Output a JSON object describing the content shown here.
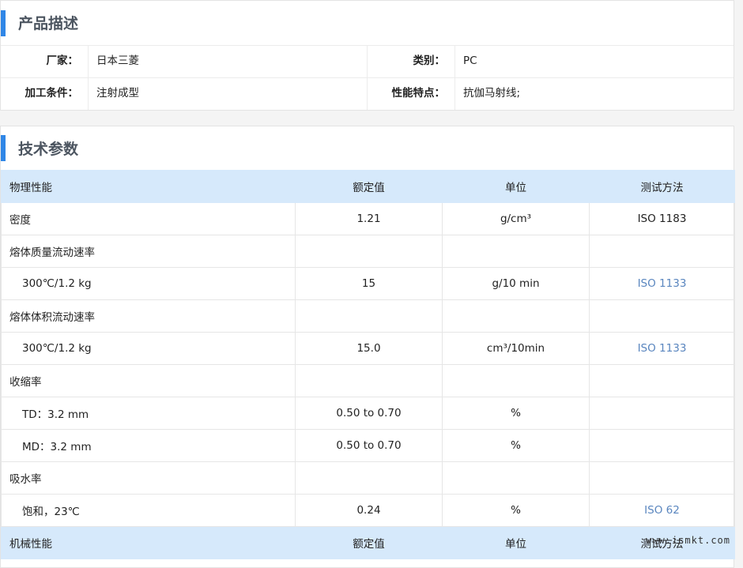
{
  "description_panel": {
    "title": "产品描述",
    "rows": [
      {
        "label1": "厂家：",
        "value1": "日本三菱",
        "label2": "类别：",
        "value2": "PC"
      },
      {
        "label1": "加工条件：",
        "value1": "注射成型",
        "label2": "性能特点：",
        "value2": "抗伽马射线;"
      }
    ]
  },
  "params_panel": {
    "title": "技术参数",
    "header": [
      "物理性能",
      "额定值",
      "单位",
      "测试方法"
    ],
    "rows": [
      [
        "密度",
        "1.21",
        "g/cm³",
        "ISO 1183"
      ],
      [
        "熔体质量流动速率",
        "",
        "",
        ""
      ],
      [
        "300℃/1.2 kg",
        "15",
        "g/10 min",
        "ISO 1133"
      ],
      [
        "熔体体积流动速率",
        "",
        "",
        ""
      ],
      [
        "300℃/1.2 kg",
        "15.0",
        "cm³/10min",
        "ISO 1133"
      ],
      [
        "收缩率",
        "",
        "",
        ""
      ],
      [
        "TD：3.2 mm",
        "0.50 to 0.70",
        "%",
        ""
      ],
      [
        "MD：3.2 mm",
        "0.50 to 0.70",
        "%",
        ""
      ],
      [
        "吸水率",
        "",
        "",
        ""
      ],
      [
        "饱和，23℃",
        "0.24",
        "%",
        "ISO 62"
      ]
    ],
    "header2": [
      "机械性能",
      "额定值",
      "单位",
      "测试方法"
    ]
  },
  "watermark": "www.ismkt.com",
  "colors": {
    "accent": "#2f86e6",
    "header_bg": "#d6e9fb",
    "link": "#5a86bf"
  }
}
